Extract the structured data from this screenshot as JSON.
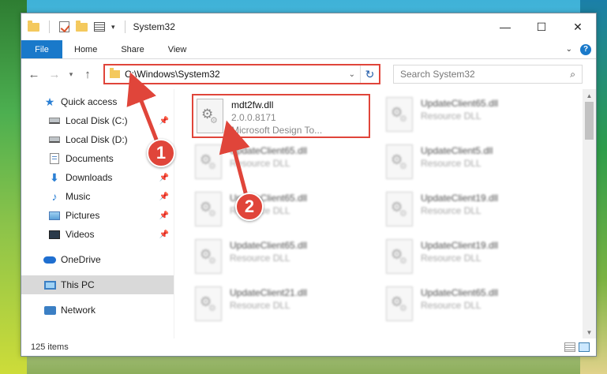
{
  "window": {
    "title": "System32"
  },
  "ribbon": {
    "tabs": [
      "File",
      "Home",
      "Share",
      "View"
    ]
  },
  "address": {
    "path": "C:\\Windows\\System32"
  },
  "search": {
    "placeholder": "Search System32"
  },
  "sidebar": {
    "items": [
      {
        "label": "Quick access",
        "icon": "star-icon"
      },
      {
        "label": "Local Disk (C:)",
        "icon": "disk-icon"
      },
      {
        "label": "Local Disk (D:)",
        "icon": "disk-icon"
      },
      {
        "label": "Documents",
        "icon": "documents-icon"
      },
      {
        "label": "Downloads",
        "icon": "downloads-icon"
      },
      {
        "label": "Music",
        "icon": "music-icon"
      },
      {
        "label": "Pictures",
        "icon": "pictures-icon"
      },
      {
        "label": "Videos",
        "icon": "videos-icon"
      },
      {
        "label": "OneDrive",
        "icon": "cloud-icon"
      },
      {
        "label": "This PC",
        "icon": "pc-icon"
      },
      {
        "label": "Network",
        "icon": "network-icon"
      }
    ]
  },
  "files": {
    "highlighted": {
      "name": "mdt2fw.dll",
      "version": "2.0.0.8171",
      "description": "Microsoft Design To..."
    },
    "items": [
      {
        "name": "UpdateClient65.dll",
        "type": "Resource DLL"
      },
      {
        "name": "UpdateClient65.dll",
        "type": "Resource DLL"
      },
      {
        "name": "UpdateClient5.dll",
        "type": "Resource DLL"
      },
      {
        "name": "UpdateClient65.dll",
        "type": "Resource DLL"
      },
      {
        "name": "UpdateClient19.dll",
        "type": "Resource DLL"
      },
      {
        "name": "UpdateClient65.dll",
        "type": "Resource DLL"
      },
      {
        "name": "UpdateClient19.dll",
        "type": "Resource DLL"
      },
      {
        "name": "UpdateClient21.dll",
        "type": "Resource DLL"
      },
      {
        "name": "UpdateClient65.dll",
        "type": "Resource DLL"
      }
    ]
  },
  "status": {
    "count": "125 items"
  },
  "callouts": [
    "1",
    "2"
  ],
  "colors": {
    "highlight": "#e0453a",
    "accent": "#1979ca"
  }
}
